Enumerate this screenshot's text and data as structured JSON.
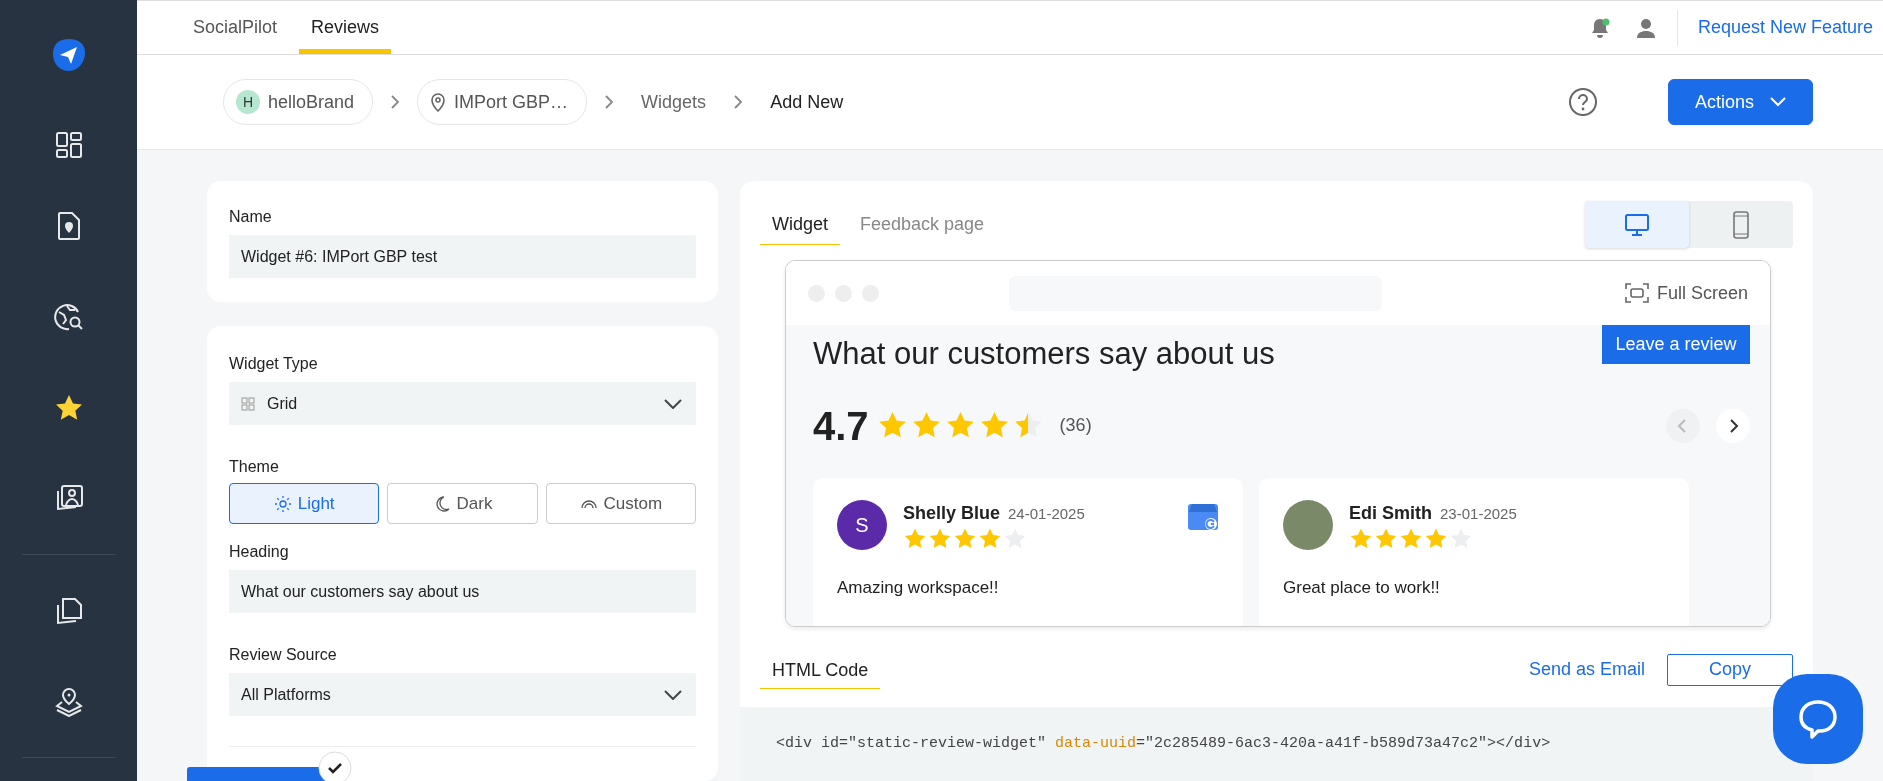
{
  "sidebar": {
    "items": [
      {
        "kind": "item",
        "selected": false
      },
      {
        "kind": "item",
        "selected": false
      },
      {
        "kind": "item",
        "selected": false
      },
      {
        "kind": "item",
        "selected": true
      },
      {
        "kind": "item",
        "selected": false
      },
      {
        "kind": "divider"
      },
      {
        "kind": "item",
        "selected": false
      },
      {
        "kind": "item",
        "selected": false
      },
      {
        "kind": "divider"
      }
    ]
  },
  "top_tabs": [
    {
      "label": "SocialPilot",
      "selected": false
    },
    {
      "label": "Reviews",
      "selected": true
    }
  ],
  "top_bar": {
    "has_notification": true,
    "link": "Request New Feature"
  },
  "breadcrumb": [
    {
      "kind": "brand",
      "label": "helloBrand",
      "initial": "H"
    },
    {
      "kind": "location",
      "label": "IMPort GBP…"
    },
    {
      "kind": "plain",
      "label": "Widgets"
    },
    {
      "kind": "current",
      "label": "Add New"
    }
  ],
  "actions_button": "Actions",
  "form": {
    "name_label": "Name",
    "name_value": "Widget #6: IMPort GBP test",
    "type_label": "Widget Type",
    "type_value": "Grid",
    "theme_label": "Theme",
    "themes": [
      {
        "kind": "sun",
        "label": "Light",
        "selected": true
      },
      {
        "kind": "moon",
        "label": "Dark",
        "selected": false
      },
      {
        "kind": "rainbow",
        "label": "Custom",
        "selected": false
      }
    ],
    "heading_label": "Heading",
    "heading_value": "What our customers say about us",
    "source_label": "Review Source",
    "source_value": "All Platforms"
  },
  "preview_tabs": [
    {
      "label": "Widget",
      "selected": true
    },
    {
      "label": "Feedback page",
      "selected": false
    }
  ],
  "devices": [
    {
      "kind": "desktop",
      "selected": true
    },
    {
      "kind": "mobile",
      "selected": false
    }
  ],
  "preview": {
    "full_screen": "Full Screen",
    "heading": "What our customers say about us",
    "button": "Leave a review",
    "rating": "4.7",
    "stars": 4.5,
    "count": "(36)",
    "reviews": [
      {
        "name": "Shelly Blue",
        "date": "24-01-2025",
        "kind": "letter",
        "initial": "S",
        "stars": 4,
        "text": "Amazing workspace!!",
        "source_logo": true
      },
      {
        "name": "Edi Smith",
        "date": "23-01-2025",
        "kind": "photo",
        "stars": 4,
        "text": "Great place to work!!",
        "source_logo": false
      }
    ]
  },
  "code_section": {
    "tab": "HTML Code",
    "email_link": "Send as Email",
    "copy_button": "Copy",
    "code": [
      {
        "kind": "plain",
        "text": "<div id=\"static-review-widget\" "
      },
      {
        "kind": "attr",
        "text": "data-uuid"
      },
      {
        "kind": "plain",
        "text": "=\"2c285489-6ac3-420a-a41f-b589d73a47c2\"></div>"
      }
    ]
  }
}
